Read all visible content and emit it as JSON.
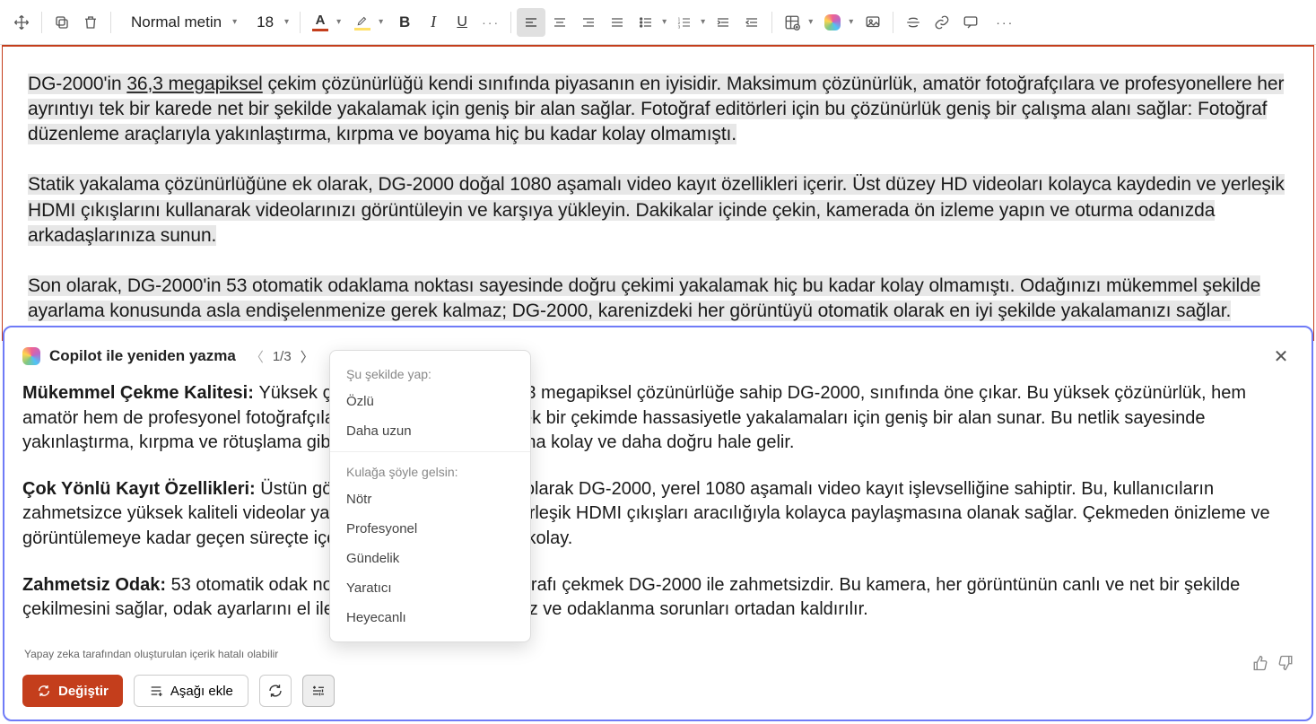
{
  "toolbar": {
    "style_label": "Normal metin",
    "font_size": "18"
  },
  "document": {
    "p1_lead": "DG-2000'in ",
    "p1_link": "36,3 megapiksel",
    "p1_rest": " çekim çözünürlüğü kendi sınıfında piyasanın en iyisidir. Maksimum çözünürlük, amatör fotoğrafçılara ve profesyonellere her ayrıntıyı tek bir karede net bir şekilde yakalamak için geniş bir alan sağlar. Fotoğraf editörleri için bu çözünürlük geniş bir çalışma alanı sağlar: Fotoğraf düzenleme araçlarıyla yakınlaştırma, kırpma ve boyama hiç bu kadar kolay olmamıştı.",
    "p2": "Statik yakalama çözünürlüğüne ek olarak, DG-2000 doğal 1080 aşamalı video kayıt özellikleri içerir. Üst düzey HD videoları kolayca kaydedin ve yerleşik HDMI çıkışlarını kullanarak videolarınızı görüntüleyin ve karşıya yükleyin. Dakikalar içinde çekin, kamerada ön izleme yapın ve oturma odanızda arkadaşlarınıza sunun.",
    "p3": "Son olarak, DG-2000'in 53 otomatik odaklama noktası sayesinde doğru çekimi yakalamak hiç bu kadar kolay olmamıştı. Odağınızı mükemmel şekilde ayarlama konusunda asla endişelenmenize gerek kalmaz; DG-2000, karenizdeki her görüntüyü otomatik olarak en iyi şekilde yakalamanızı sağlar."
  },
  "copilot": {
    "title": "Copilot ile yeniden yazma",
    "page": "1/3",
    "sec1_title": "Mükemmel Çekme Kalitesi: ",
    "sec1_body": "Yüksek çekim çözünürlüğü ve 36,3 megapiksel çözünürlüğe sahip DG-2000, sınıfında öne çıkar. Bu yüksek çözünürlük, hem amatör hem de profesyonel fotoğrafçıların en küçük ayrıntıları tek bir çekimde hassasiyetle yakalamaları için geniş bir alan sunar. Bu netlik sayesinde yakınlaştırma, kırpma ve rötuşlama gibi düzenleme görevleri daha kolay ve daha doğru hale gelir.",
    "sec2_title": "Çok Yönlü Kayıt Özellikleri: ",
    "sec2_body": "Üstün görüntü çözünürlüğüne ek olarak DG-2000, yerel 1080 aşamalı video kayıt işlevselliğine sahiptir. Bu, kullanıcıların zahmetsizce yüksek kaliteli videolar yakalamasına ve bunları yerleşik HDMI çıkışları aracılığıyla kolayca paylaşmasına olanak sağlar. Çekmeden önizleme ve görüntülemeye kadar geçen süreçte içerik paylaşımı artık daha kolay.",
    "sec3_title": "Zahmetsiz Odak: ",
    "sec3_body": "53 otomatik odak noktasıyla mükemmel fotoğrafı çekmek DG-2000 ile zahmetsizdir. Bu kamera, her görüntünün canlı ve net bir şekilde çekilmesini sağlar, odak ayarlarını el ile yapmanıza gerek kalmaz ve odaklanma sorunları ortadan kaldırılır.",
    "footnote": "Yapay zeka tarafından oluşturulan içerik hatalı olabilir",
    "replace_label": "Değiştir",
    "insert_label": "Aşağı ekle"
  },
  "popup": {
    "group1_label": "Şu şekilde yap:",
    "group1_items": [
      "Özlü",
      "Daha uzun"
    ],
    "group2_label": "Kulağa şöyle gelsin:",
    "group2_items": [
      "Nötr",
      "Profesyonel",
      "Gündelik",
      "Yaratıcı",
      "Heyecanlı"
    ]
  }
}
